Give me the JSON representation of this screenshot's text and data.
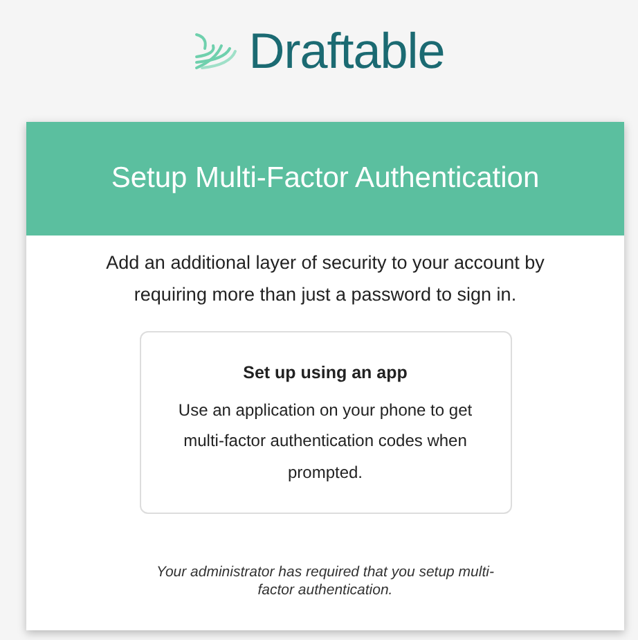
{
  "logo": {
    "text": "Draftable"
  },
  "card": {
    "title": "Setup Multi-Factor Authentication",
    "intro": "Add an additional layer of security to your account by requiring more than just a password to sign in.",
    "options": [
      {
        "title": "Set up using an app",
        "description": "Use an application on your phone to get multi-factor authentication codes when prompted."
      }
    ],
    "note": "Your administrator has required that you setup multi-factor authentication."
  }
}
